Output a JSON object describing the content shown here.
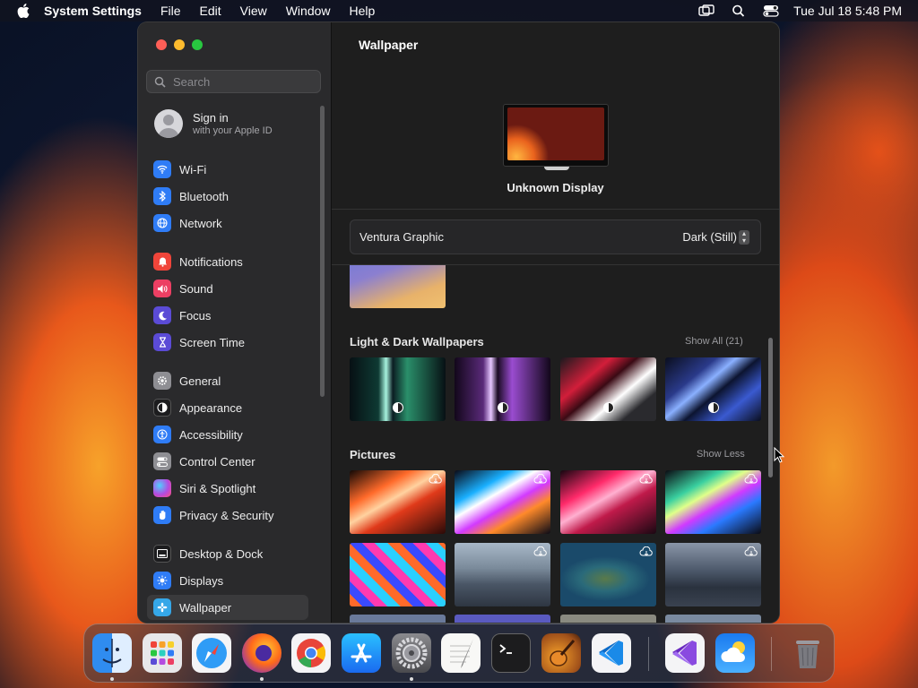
{
  "menubar": {
    "app": "System Settings",
    "items": [
      "File",
      "Edit",
      "View",
      "Window",
      "Help"
    ],
    "clock": "Tue Jul 18  5:48 PM"
  },
  "search": {
    "placeholder": "Search"
  },
  "account": {
    "title": "Sign in",
    "subtitle": "with your Apple ID"
  },
  "sidebar": {
    "items": [
      {
        "label": "Wi-Fi",
        "icon": "wifi-icon",
        "color": "#2f7cf6"
      },
      {
        "label": "Bluetooth",
        "icon": "bluetooth-icon",
        "color": "#2f7cf6"
      },
      {
        "label": "Network",
        "icon": "globe-icon",
        "color": "#2f7cf6"
      },
      {
        "label": "Notifications",
        "icon": "bell-icon",
        "color": "#f0453a"
      },
      {
        "label": "Sound",
        "icon": "speaker-icon",
        "color": "#ec3f63"
      },
      {
        "label": "Focus",
        "icon": "moon-icon",
        "color": "#5b4bd6"
      },
      {
        "label": "Screen Time",
        "icon": "hourglass-icon",
        "color": "#5b4bd6"
      },
      {
        "label": "General",
        "icon": "gear-icon",
        "color": "#8e8e93"
      },
      {
        "label": "Appearance",
        "icon": "appearance-icon",
        "color": "#1c1c1e"
      },
      {
        "label": "Accessibility",
        "icon": "accessibility-icon",
        "color": "#2f7cf6"
      },
      {
        "label": "Control Center",
        "icon": "control-center-icon",
        "color": "#8e8e93"
      },
      {
        "label": "Siri & Spotlight",
        "icon": "siri-icon",
        "color": "#b44be0"
      },
      {
        "label": "Privacy & Security",
        "icon": "hand-icon",
        "color": "#2f7cf6"
      },
      {
        "label": "Desktop & Dock",
        "icon": "dock-icon",
        "color": "#1c1c1e"
      },
      {
        "label": "Displays",
        "icon": "sun-icon",
        "color": "#2f7cf6"
      },
      {
        "label": "Wallpaper",
        "icon": "wallpaper-icon",
        "color": "#35a7e8"
      }
    ],
    "selected": "Wallpaper"
  },
  "main": {
    "title": "Wallpaper",
    "display_name": "Unknown Display",
    "wallpaper_name": "Ventura Graphic",
    "wallpaper_mode": "Dark (Still)",
    "section_light_dark": "Light & Dark Wallpapers",
    "show_all": "Show All (21)",
    "section_pictures": "Pictures",
    "show_less": "Show Less"
  },
  "dock": {
    "apps": [
      "Finder",
      "Launchpad",
      "Safari",
      "Firefox",
      "Chrome",
      "App Store",
      "System Settings",
      "TextEdit",
      "Terminal",
      "GarageBand",
      "Visual Studio Code",
      "Visual Studio",
      "Weather",
      "Trash"
    ]
  }
}
